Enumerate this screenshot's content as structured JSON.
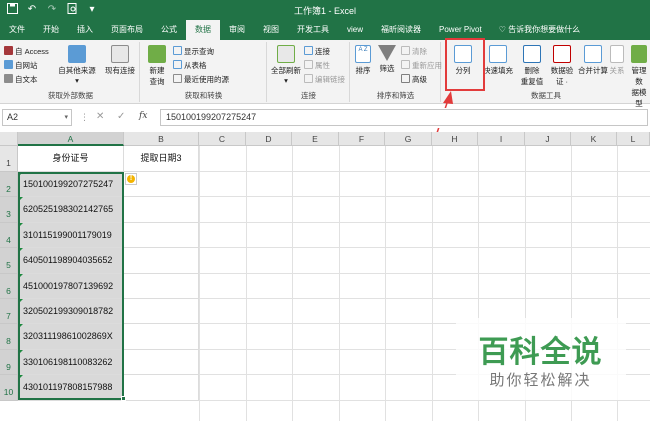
{
  "titlebar": {
    "title": "工作簿1 - Excel"
  },
  "qat": {
    "save_icon": "save-icon",
    "undo_icon": "undo-icon",
    "redo_icon": "redo-icon",
    "preview_icon": "print-preview-icon"
  },
  "tabs": [
    "文件",
    "开始",
    "插入",
    "页面布局",
    "公式",
    "数据",
    "审阅",
    "视图",
    "开发工具",
    "view",
    "福昕阅读器",
    "Power Pivot"
  ],
  "active_tab": "数据",
  "tell_me": "告诉我你想要做什么",
  "ribbon": {
    "get_external": {
      "access": "自 Access",
      "web": "自网站",
      "text": "自文本",
      "other": "自其他来源",
      "existing": "现有连接",
      "label": "获取外部数据"
    },
    "get_transform": {
      "new_query": "新建\n查询",
      "show_queries": "显示查询",
      "from_table": "从表格",
      "recent_sources": "最近使用的源",
      "label": "获取和转换"
    },
    "connections": {
      "refresh_all": "全部刷新",
      "conn": "连接",
      "props": "属性",
      "edit_links": "编辑链接",
      "label": "连接"
    },
    "sort_filter": {
      "sort": "排序",
      "filter": "筛选",
      "clear": "清除",
      "reapply": "重新应用",
      "advanced": "高级",
      "label": "排序和筛选"
    },
    "data_tools": {
      "text_to_columns": "分列",
      "flash_fill": "快速填充",
      "remove_dup": "删除\n重复值",
      "validation": "数据验\n证 ·",
      "consolidate": "合并计算",
      "relationships": "关系",
      "manage_model": "管理数\n据模型",
      "label": "数据工具"
    }
  },
  "formula_bar": {
    "name_box": "A2",
    "fx": "fx",
    "value": "150100199207275247"
  },
  "columns": [
    "A",
    "B",
    "C",
    "D",
    "E",
    "F",
    "G",
    "H",
    "I",
    "J",
    "K",
    "L"
  ],
  "rows": [
    "1",
    "2",
    "3",
    "4",
    "5",
    "6",
    "7",
    "8",
    "9",
    "10"
  ],
  "sheet": {
    "header_a": "身份证号",
    "header_b": "提取日期3",
    "ids": [
      "150100199207275247",
      "620525198302142765",
      "310115199001179019",
      "640501198904035652",
      "451000197807139692",
      "320502199309018782",
      "32031119861002869X",
      "330106198110083262",
      "430101197808157988"
    ]
  },
  "watermark": {
    "line1": "百科全说",
    "line2": "助你轻松解决"
  },
  "colors": {
    "excel_green": "#217346",
    "highlight_red": "#e23b3b"
  }
}
